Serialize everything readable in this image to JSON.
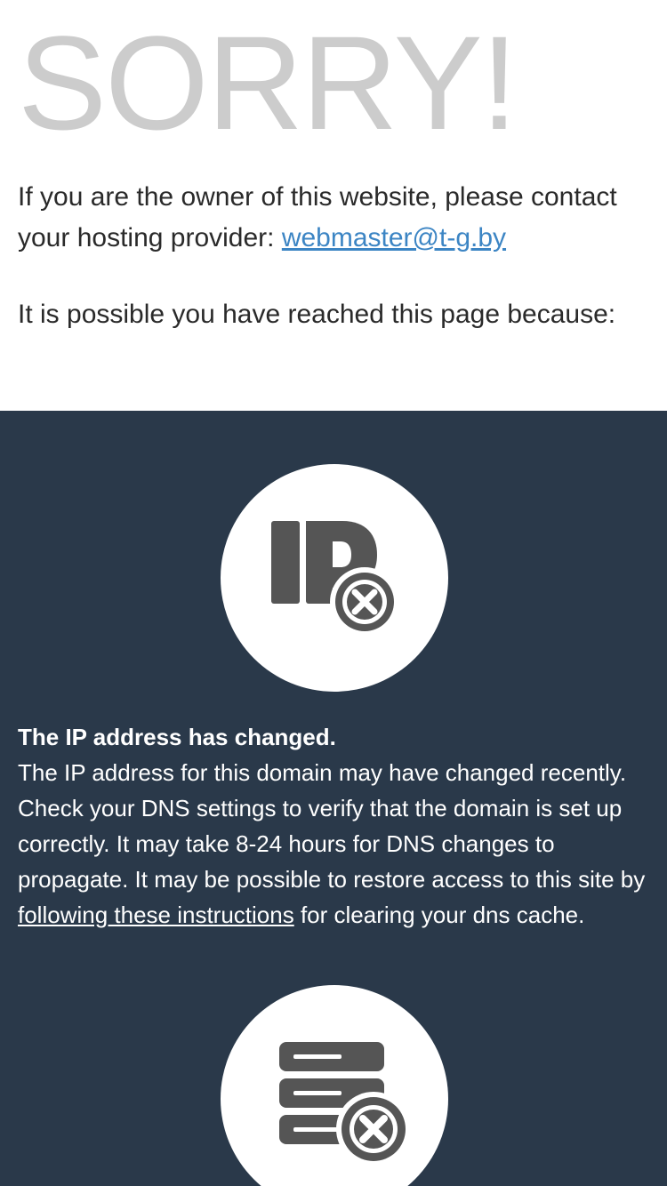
{
  "header": {
    "headline": "SORRY!"
  },
  "intro": {
    "owner_text": "If you are the owner of this website, please contact your hosting provider: ",
    "contact_email": "webmaster@t-g.by",
    "reason_intro": "It is possible you have reached this page because:"
  },
  "reasons": [
    {
      "icon": "ip-error-icon",
      "title": "The IP address has changed.",
      "body_before_link": "The IP address for this domain may have changed recently. Check your DNS settings to verify that the domain is set up correctly. It may take 8-24 hours for DNS changes to propagate. It may be possible to restore access to this site by ",
      "link_text": "following these instructions",
      "body_after_link": " for clearing your dns cache."
    },
    {
      "icon": "server-error-icon"
    }
  ],
  "colors": {
    "headline": "#cccccc",
    "text": "#2a2a2a",
    "link": "#3c85c4",
    "dark_background": "#2a394a",
    "icon_gray": "#555555"
  }
}
